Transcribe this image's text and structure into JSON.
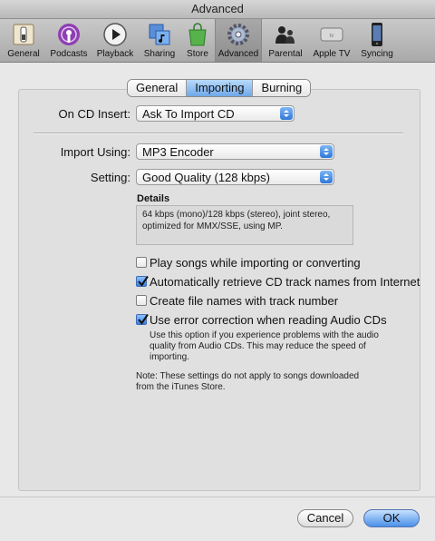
{
  "window": {
    "title": "Advanced"
  },
  "toolbar": {
    "items": [
      {
        "label": "General",
        "icon": "switch-icon"
      },
      {
        "label": "Podcasts",
        "icon": "podcast-icon"
      },
      {
        "label": "Playback",
        "icon": "play-icon"
      },
      {
        "label": "Sharing",
        "icon": "sharing-icon"
      },
      {
        "label": "Store",
        "icon": "store-bag-icon"
      },
      {
        "label": "Advanced",
        "icon": "gear-icon",
        "selected": true
      },
      {
        "label": "Parental",
        "icon": "parental-icon"
      },
      {
        "label": "Apple TV",
        "icon": "apple-tv-icon"
      },
      {
        "label": "Syncing",
        "icon": "iphone-icon"
      }
    ]
  },
  "tabs": [
    {
      "label": "General"
    },
    {
      "label": "Importing",
      "active": true
    },
    {
      "label": "Burning"
    }
  ],
  "on_cd_insert": {
    "label": "On CD Insert:",
    "value": "Ask To Import CD"
  },
  "import_using": {
    "label": "Import Using:",
    "value": "MP3 Encoder"
  },
  "setting": {
    "label": "Setting:",
    "value": "Good Quality (128 kbps)"
  },
  "details": {
    "title": "Details",
    "text": "64 kbps (mono)/128 kbps (stereo), joint stereo, optimized for MMX/SSE, using MP."
  },
  "options": [
    {
      "label": "Play songs while importing or converting",
      "checked": false
    },
    {
      "label": "Automatically retrieve CD track names from Internet",
      "checked": true
    },
    {
      "label": "Create file names with track number",
      "checked": false
    },
    {
      "label": "Use error correction when reading Audio CDs",
      "checked": true
    }
  ],
  "error_correction_hint": "Use this option if you experience problems with the audio quality from Audio CDs. This may reduce the speed of importing.",
  "note": "Note: These settings do not apply to songs downloaded from the iTunes Store.",
  "buttons": {
    "cancel": "Cancel",
    "ok": "OK"
  },
  "colors": {
    "accent": "#4a90e8",
    "window_bg": "#e8e8e8"
  }
}
